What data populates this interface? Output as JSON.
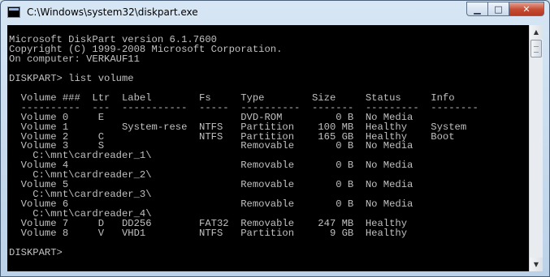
{
  "window": {
    "title": "C:\\Windows\\system32\\diskpart.exe",
    "icon": "console-icon",
    "minimize_glyph": "▁",
    "maximize_glyph": "□",
    "close_glyph": "✕"
  },
  "console": {
    "lines": [
      "Microsoft DiskPart version 6.1.7600",
      "Copyright (C) 1999-2008 Microsoft Corporation.",
      "On computer: VERKAUF11",
      "",
      "DISKPART> list volume",
      "",
      "  Volume ###  Ltr  Label        Fs     Type        Size     Status     Info",
      "  ----------  ---  -----------  -----  ----------  -------  ---------  --------",
      "  Volume 0     E                       DVD-ROM         0 B  No Media",
      "  Volume 1         System-rese  NTFS   Partition    100 MB  Healthy    System",
      "  Volume 2     C                NTFS   Partition    165 GB  Healthy    Boot",
      "  Volume 3     S                       Removable       0 B  No Media",
      "    C:\\mnt\\cardreader_1\\",
      "  Volume 4                             Removable       0 B  No Media",
      "    C:\\mnt\\cardreader_2\\",
      "  Volume 5                             Removable       0 B  No Media",
      "    C:\\mnt\\cardreader_3\\",
      "  Volume 6                             Removable       0 B  No Media",
      "    C:\\mnt\\cardreader_4\\",
      "  Volume 7     D   DD256        FAT32  Removable    247 MB  Healthy",
      "  Volume 8     V   VHD1         NTFS   Partition      9 GB  Healthy",
      "",
      "DISKPART> "
    ]
  },
  "scrollbar": {
    "up_glyph": "▲",
    "down_glyph": "▼"
  },
  "colors": {
    "console_background": "#000000",
    "console_text": "#c0c0c0",
    "close_button": "#c64b32"
  }
}
